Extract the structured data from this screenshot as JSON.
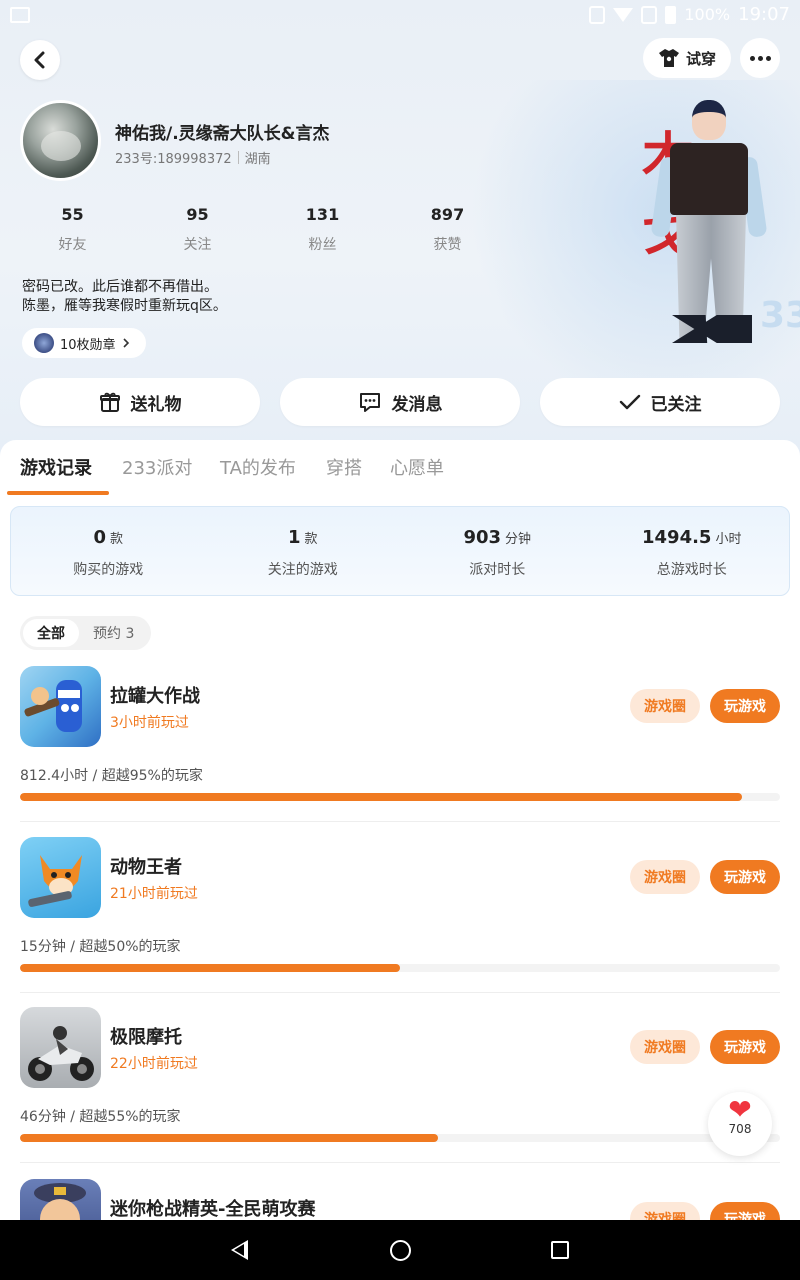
{
  "status_bar": {
    "battery": "100%",
    "time": "19:07"
  },
  "header": {
    "try_on_label": "试穿"
  },
  "profile": {
    "name": "神佑我/.灵缘斋大队长&言杰",
    "id_text": "233号:189998372",
    "location": "湖南",
    "stats": [
      {
        "value": "55",
        "label": "好友"
      },
      {
        "value": "95",
        "label": "关注"
      },
      {
        "value": "131",
        "label": "粉丝"
      },
      {
        "value": "897",
        "label": "获赞"
      }
    ],
    "bio_line1": "密码已改。此后谁都不再借出。",
    "bio_line2": "陈墨，雁等我寒假时重新玩q区。",
    "medals_label": "10枚勋章"
  },
  "actions": {
    "gift": "送礼物",
    "message": "发消息",
    "followed": "已关注"
  },
  "tabs": [
    "游戏记录",
    "233派对",
    "TA的发布",
    "穿搭",
    "心愿单"
  ],
  "summary": [
    {
      "value": "0",
      "unit": "款",
      "label": "购买的游戏"
    },
    {
      "value": "1",
      "unit": "款",
      "label": "关注的游戏"
    },
    {
      "value": "903",
      "unit": "分钟",
      "label": "派对时长"
    },
    {
      "value": "1494.5",
      "unit": "小时",
      "label": "总游戏时长"
    }
  ],
  "filters": {
    "all": "全部",
    "reserve": "预约 3"
  },
  "game_buttons": {
    "circle": "游戏圈",
    "play": "玩游戏"
  },
  "games": [
    {
      "name": "拉罐大作战",
      "last_played": "3小时前玩过",
      "stat": "812.4小时 / 超越95%的玩家",
      "progress_percent": 95
    },
    {
      "name": "动物王者",
      "last_played": "21小时前玩过",
      "stat": "15分钟 / 超越50%的玩家",
      "progress_percent": 50
    },
    {
      "name": "极限摩托",
      "last_played": "22小时前玩过",
      "stat": "46分钟 / 超越55%的玩家",
      "progress_percent": 55
    },
    {
      "name": "迷你枪战精英-全民萌攻赛",
      "last_played": "",
      "stat": "",
      "progress_percent": 0
    }
  ],
  "like": {
    "count": "708"
  },
  "colors": {
    "accent": "#f07a21",
    "accent_light": "#fde8d8",
    "heart": "#f0353f"
  }
}
